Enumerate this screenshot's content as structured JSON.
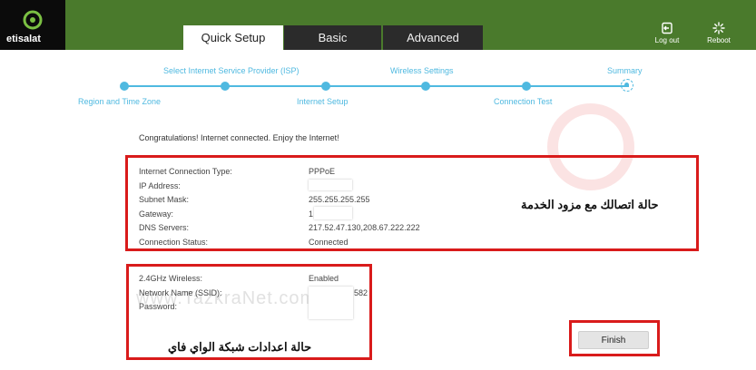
{
  "brand": {
    "name": "etisalat",
    "colors": {
      "topbar": "#4a7a2c",
      "accent": "#4fb9e0",
      "highlight": "#d91b1b"
    }
  },
  "tabs": [
    {
      "label": "Quick Setup",
      "active": true
    },
    {
      "label": "Basic",
      "active": false
    },
    {
      "label": "Advanced",
      "active": false
    }
  ],
  "header_buttons": {
    "logout": "Log out",
    "reboot": "Reboot",
    "logout_icon": "logout-icon",
    "reboot_icon": "reboot-icon"
  },
  "steps": [
    {
      "label": "Region and Time Zone"
    },
    {
      "label": "Select Internet Service Provider (ISP)"
    },
    {
      "label": "Internet Setup"
    },
    {
      "label": "Wireless Settings"
    },
    {
      "label": "Connection Test"
    },
    {
      "label": "Summary"
    }
  ],
  "congrats": "Congratulations! Internet connected. Enjoy the Internet!",
  "internet": {
    "rows": [
      {
        "label": "Internet Connection Type:",
        "value": "PPPoE"
      },
      {
        "label": "IP Address:",
        "value": ""
      },
      {
        "label": "Subnet Mask:",
        "value": "255.255.255.255"
      },
      {
        "label": "Gateway:",
        "value": "1"
      },
      {
        "label": "DNS Servers:",
        "value": "217.52.47.130,208.67.222.222"
      },
      {
        "label": "Connection Status:",
        "value": "Connected"
      }
    ]
  },
  "wireless": {
    "rows": [
      {
        "label": "2.4GHz Wireless:",
        "value": "Enabled"
      },
      {
        "label": "Network Name (SSID):",
        "value": "582"
      },
      {
        "label": "Password:",
        "value": ""
      }
    ]
  },
  "annotations": {
    "isp_status": "حالة اتصالك مع مزود الخدمة",
    "wifi_status": "حالة اعدادات شبكة الواي فاي"
  },
  "finish_label": "Finish",
  "watermark": "www.TazkraNet.com"
}
